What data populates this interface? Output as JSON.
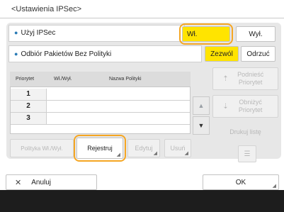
{
  "title": "<Ustawienia IPSec>",
  "use_ipsec": {
    "label": "Użyj IPSec",
    "on_label": "Wł.",
    "off_label": "Wył."
  },
  "policy_receive": {
    "label": "Odbiór Pakietów Bez Polityki",
    "allow_label": "Zezwól",
    "reject_label": "Odrzuć"
  },
  "table": {
    "headers": [
      "Priorytet",
      "Wł./Wył.",
      "Nazwa Polityki"
    ],
    "rows": [
      {
        "num": "1"
      },
      {
        "num": "2"
      },
      {
        "num": "3"
      }
    ]
  },
  "side": {
    "raise_label": "Podnieść Priorytet",
    "lower_label": "Obniżyć Priorytet",
    "print_label": "Drukuj listę"
  },
  "actions": {
    "policy_onoff": "Polityka Wł./Wył.",
    "register": "Rejestruj",
    "edit": "Edytuj",
    "delete": "Usuń"
  },
  "footer": {
    "cancel": "Anuluj",
    "ok": "OK"
  },
  "colors": {
    "accent_yellow": "#ffe400",
    "highlight_orange": "#f5a623"
  }
}
